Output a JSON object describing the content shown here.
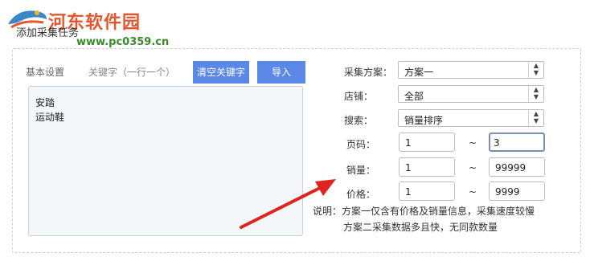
{
  "watermark": {
    "title": "河东软件园",
    "url": "www.pc0359.cn"
  },
  "dialog": {
    "title": "添加采集任务"
  },
  "left": {
    "tab_basic": "基本设置",
    "tab_keyword": "关键字（一行一个）",
    "clear_button": "清空关键字",
    "import_button": "导入",
    "keywords": [
      "安踏",
      "运动鞋"
    ]
  },
  "right": {
    "scheme_label": "采集方案：",
    "scheme_value": "方案一",
    "shop_label": "店铺：",
    "shop_value": "全部",
    "search_label": "搜索：",
    "search_value": "销量排序",
    "page_label": "页码：",
    "page_from": "1",
    "page_to": "3",
    "sales_label": "销量：",
    "sales_from": "1",
    "sales_to": "99999",
    "price_label": "价格：",
    "price_from": "1",
    "price_to": "9999",
    "range_sep": "~",
    "note_line1": "说明：方案一仅含有价格及销量信息，采集速度较慢",
    "note_line2": "方案二采集数据多且快，无同款数量"
  },
  "colors": {
    "button_blue": "#5b87e6",
    "arrow_red": "#e0231f",
    "watermark_orange": "#e4572e",
    "watermark_green": "#3a8a2a"
  },
  "icons": {
    "spinner": "up-down-spinner-icon",
    "logo": "watermark-logo-icon",
    "arrow": "red-arrow-annotation"
  }
}
